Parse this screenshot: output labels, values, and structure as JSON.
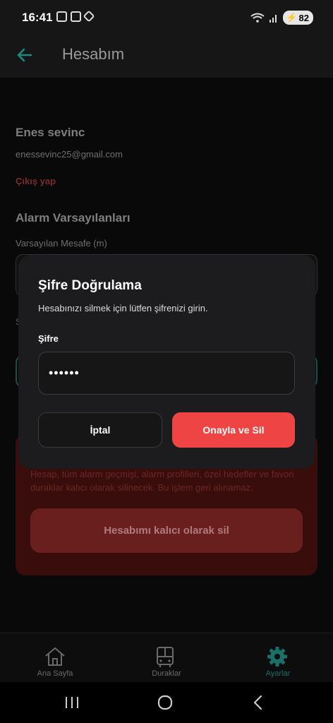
{
  "status_bar": {
    "time": "16:41",
    "battery": "82"
  },
  "app_bar": {
    "title": "Hesabım"
  },
  "profile": {
    "name": "Enes sevinc",
    "email": "enessevinc25@gmail.com",
    "logout": "Çıkış yap"
  },
  "alarm_defaults": {
    "title": "Alarm Varsayılanları",
    "distance_label": "Varsayılan Mesafe (m)"
  },
  "danger_zone": {
    "description": "Hesap, tüm alarm geçmişi, alarm profilleri, özel hedefler ve favori duraklar kalıcı olarak silinecek. Bu işlem geri alınamaz.",
    "delete_button": "Hesabımı kalıcı olarak sil"
  },
  "modal": {
    "title": "Şifre Doğrulama",
    "description": "Hesabınızı silmek için lütfen şifrenizi girin.",
    "password_label": "Şifre",
    "password_value": "••••••",
    "cancel": "İptal",
    "confirm": "Onayla ve Sil"
  },
  "bottom_nav": {
    "items": [
      {
        "label": "Ana Sayfa",
        "icon": "home-icon"
      },
      {
        "label": "Duraklar",
        "icon": "bus-icon"
      },
      {
        "label": "Ayarlar",
        "icon": "gear-icon",
        "active": true
      }
    ]
  },
  "colors": {
    "accent": "#1a8a80",
    "danger": "#ef4444",
    "background": "#0d0d0d",
    "modal": "#1c1c1e"
  }
}
